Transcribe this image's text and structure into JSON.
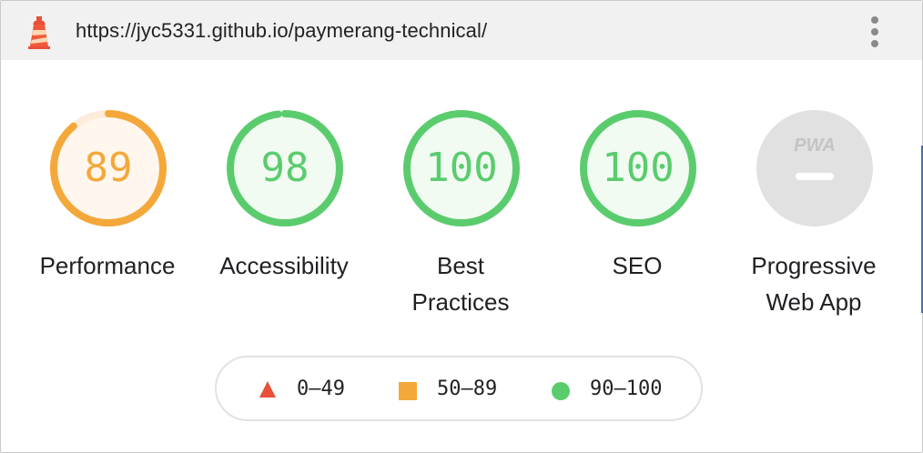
{
  "browser": {
    "url": "https://jyc5331.github.io/paymerang-technical/",
    "logo_icon": "lighthouse-icon",
    "menu_icon": "kebab-menu-icon"
  },
  "scores": [
    {
      "label": "Performance",
      "score": "89",
      "value": 89,
      "color": "#f4a83a",
      "track": "#fdf2e6",
      "bg": "#fff6ee"
    },
    {
      "label": "Accessibility",
      "score": "98",
      "value": 98,
      "color": "#5bcc6e",
      "track": "#eaf8ec",
      "bg": "#f1fbf2"
    },
    {
      "label_line1": "Best",
      "label_line2": "Practices",
      "score": "100",
      "value": 100,
      "color": "#5bcc6e",
      "track": "#eaf8ec",
      "bg": "#f1fbf2"
    },
    {
      "label": "SEO",
      "score": "100",
      "value": 100,
      "color": "#5bcc6e",
      "track": "#eaf8ec",
      "bg": "#f1fbf2"
    },
    {
      "label_line1": "Progressive",
      "label_line2": "Web App",
      "badge": "PWA",
      "color": "#cfcfcf",
      "bg": "#e1e1e1"
    }
  ],
  "legend": [
    {
      "icon": "triangle-icon",
      "range": "0–49",
      "color": "#e8503a"
    },
    {
      "icon": "square-icon",
      "range": "50–89",
      "color": "#f4a83a"
    },
    {
      "icon": "circle-icon",
      "range": "90–100",
      "color": "#5bcc6e"
    }
  ]
}
